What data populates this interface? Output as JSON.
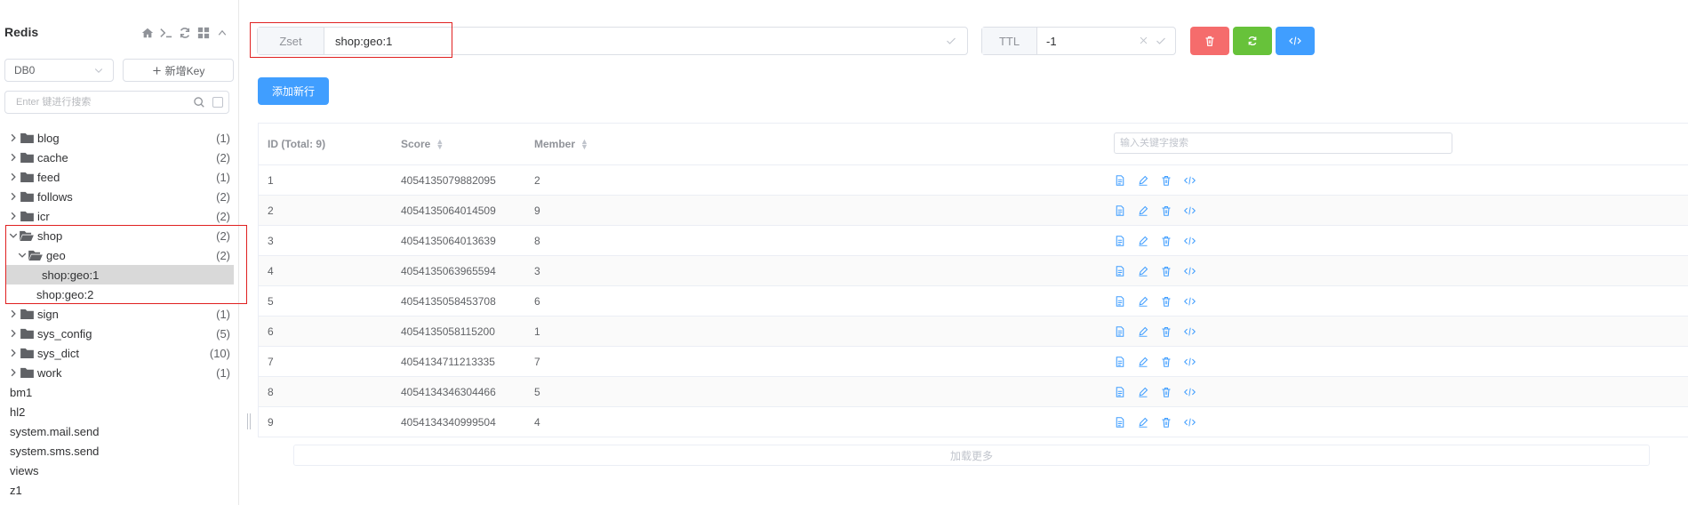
{
  "app": {
    "title": "Redis"
  },
  "sidebar": {
    "db_select": "DB0",
    "new_key_label": "新增Key",
    "search_placeholder": "Enter 键进行搜索",
    "tree": [
      {
        "label": "blog",
        "count": "(1)",
        "type": "folder",
        "level": 0,
        "open": false
      },
      {
        "label": "cache",
        "count": "(2)",
        "type": "folder",
        "level": 0,
        "open": false
      },
      {
        "label": "feed",
        "count": "(1)",
        "type": "folder",
        "level": 0,
        "open": false
      },
      {
        "label": "follows",
        "count": "(2)",
        "type": "folder",
        "level": 0,
        "open": false
      },
      {
        "label": "icr",
        "count": "(2)",
        "type": "folder",
        "level": 0,
        "open": false
      },
      {
        "label": "shop",
        "count": "(2)",
        "type": "folder",
        "level": 0,
        "open": true
      },
      {
        "label": "geo",
        "count": "(2)",
        "type": "folder",
        "level": 1,
        "open": true
      },
      {
        "label": "shop:geo:1",
        "count": "",
        "type": "key",
        "level": 2,
        "selected": true
      },
      {
        "label": "shop:geo:2",
        "count": "",
        "type": "key",
        "level": 2
      },
      {
        "label": "sign",
        "count": "(1)",
        "type": "folder",
        "level": 0,
        "open": false
      },
      {
        "label": "sys_config",
        "count": "(5)",
        "type": "folder",
        "level": 0,
        "open": false
      },
      {
        "label": "sys_dict",
        "count": "(10)",
        "type": "folder",
        "level": 0,
        "open": false
      },
      {
        "label": "work",
        "count": "(1)",
        "type": "folder",
        "level": 0,
        "open": false
      },
      {
        "label": "bm1",
        "count": "",
        "type": "key",
        "level": 0
      },
      {
        "label": "hl2",
        "count": "",
        "type": "key",
        "level": 0
      },
      {
        "label": "system.mail.send",
        "count": "",
        "type": "key",
        "level": 0
      },
      {
        "label": "system.sms.send",
        "count": "",
        "type": "key",
        "level": 0
      },
      {
        "label": "views",
        "count": "",
        "type": "key",
        "level": 0
      },
      {
        "label": "z1",
        "count": "",
        "type": "key",
        "level": 0
      }
    ]
  },
  "keybar": {
    "type": "Zset",
    "name": "shop:geo:1",
    "ttl_label": "TTL",
    "ttl_value": "-1"
  },
  "toolbar": {
    "add_row_label": "添加新行"
  },
  "table": {
    "headers": {
      "id": "ID (Total: 9)",
      "score": "Score",
      "member": "Member"
    },
    "filter_placeholder": "输入关键字搜索",
    "rows": [
      {
        "id": "1",
        "score": "4054135079882095",
        "member": "2"
      },
      {
        "id": "2",
        "score": "4054135064014509",
        "member": "9"
      },
      {
        "id": "3",
        "score": "4054135064013639",
        "member": "8"
      },
      {
        "id": "4",
        "score": "4054135063965594",
        "member": "3"
      },
      {
        "id": "5",
        "score": "4054135058453708",
        "member": "6"
      },
      {
        "id": "6",
        "score": "4054135058115200",
        "member": "1"
      },
      {
        "id": "7",
        "score": "4054134711213335",
        "member": "7"
      },
      {
        "id": "8",
        "score": "4054134346304466",
        "member": "5"
      },
      {
        "id": "9",
        "score": "4054134340999504",
        "member": "4"
      }
    ],
    "load_more_label": "加载更多"
  },
  "colors": {
    "accent": "#409eff",
    "danger": "#f56c6c",
    "success": "#67c23a",
    "highlight_border": "#e02020"
  },
  "icons": [
    "home-icon",
    "terminal-icon",
    "refresh-icon",
    "grid-icon",
    "collapse-icon",
    "search-icon",
    "folder-icon",
    "folder-open-icon",
    "chevron-right-icon",
    "chevron-down-icon",
    "delete-icon",
    "code-icon",
    "view-icon",
    "edit-icon"
  ]
}
